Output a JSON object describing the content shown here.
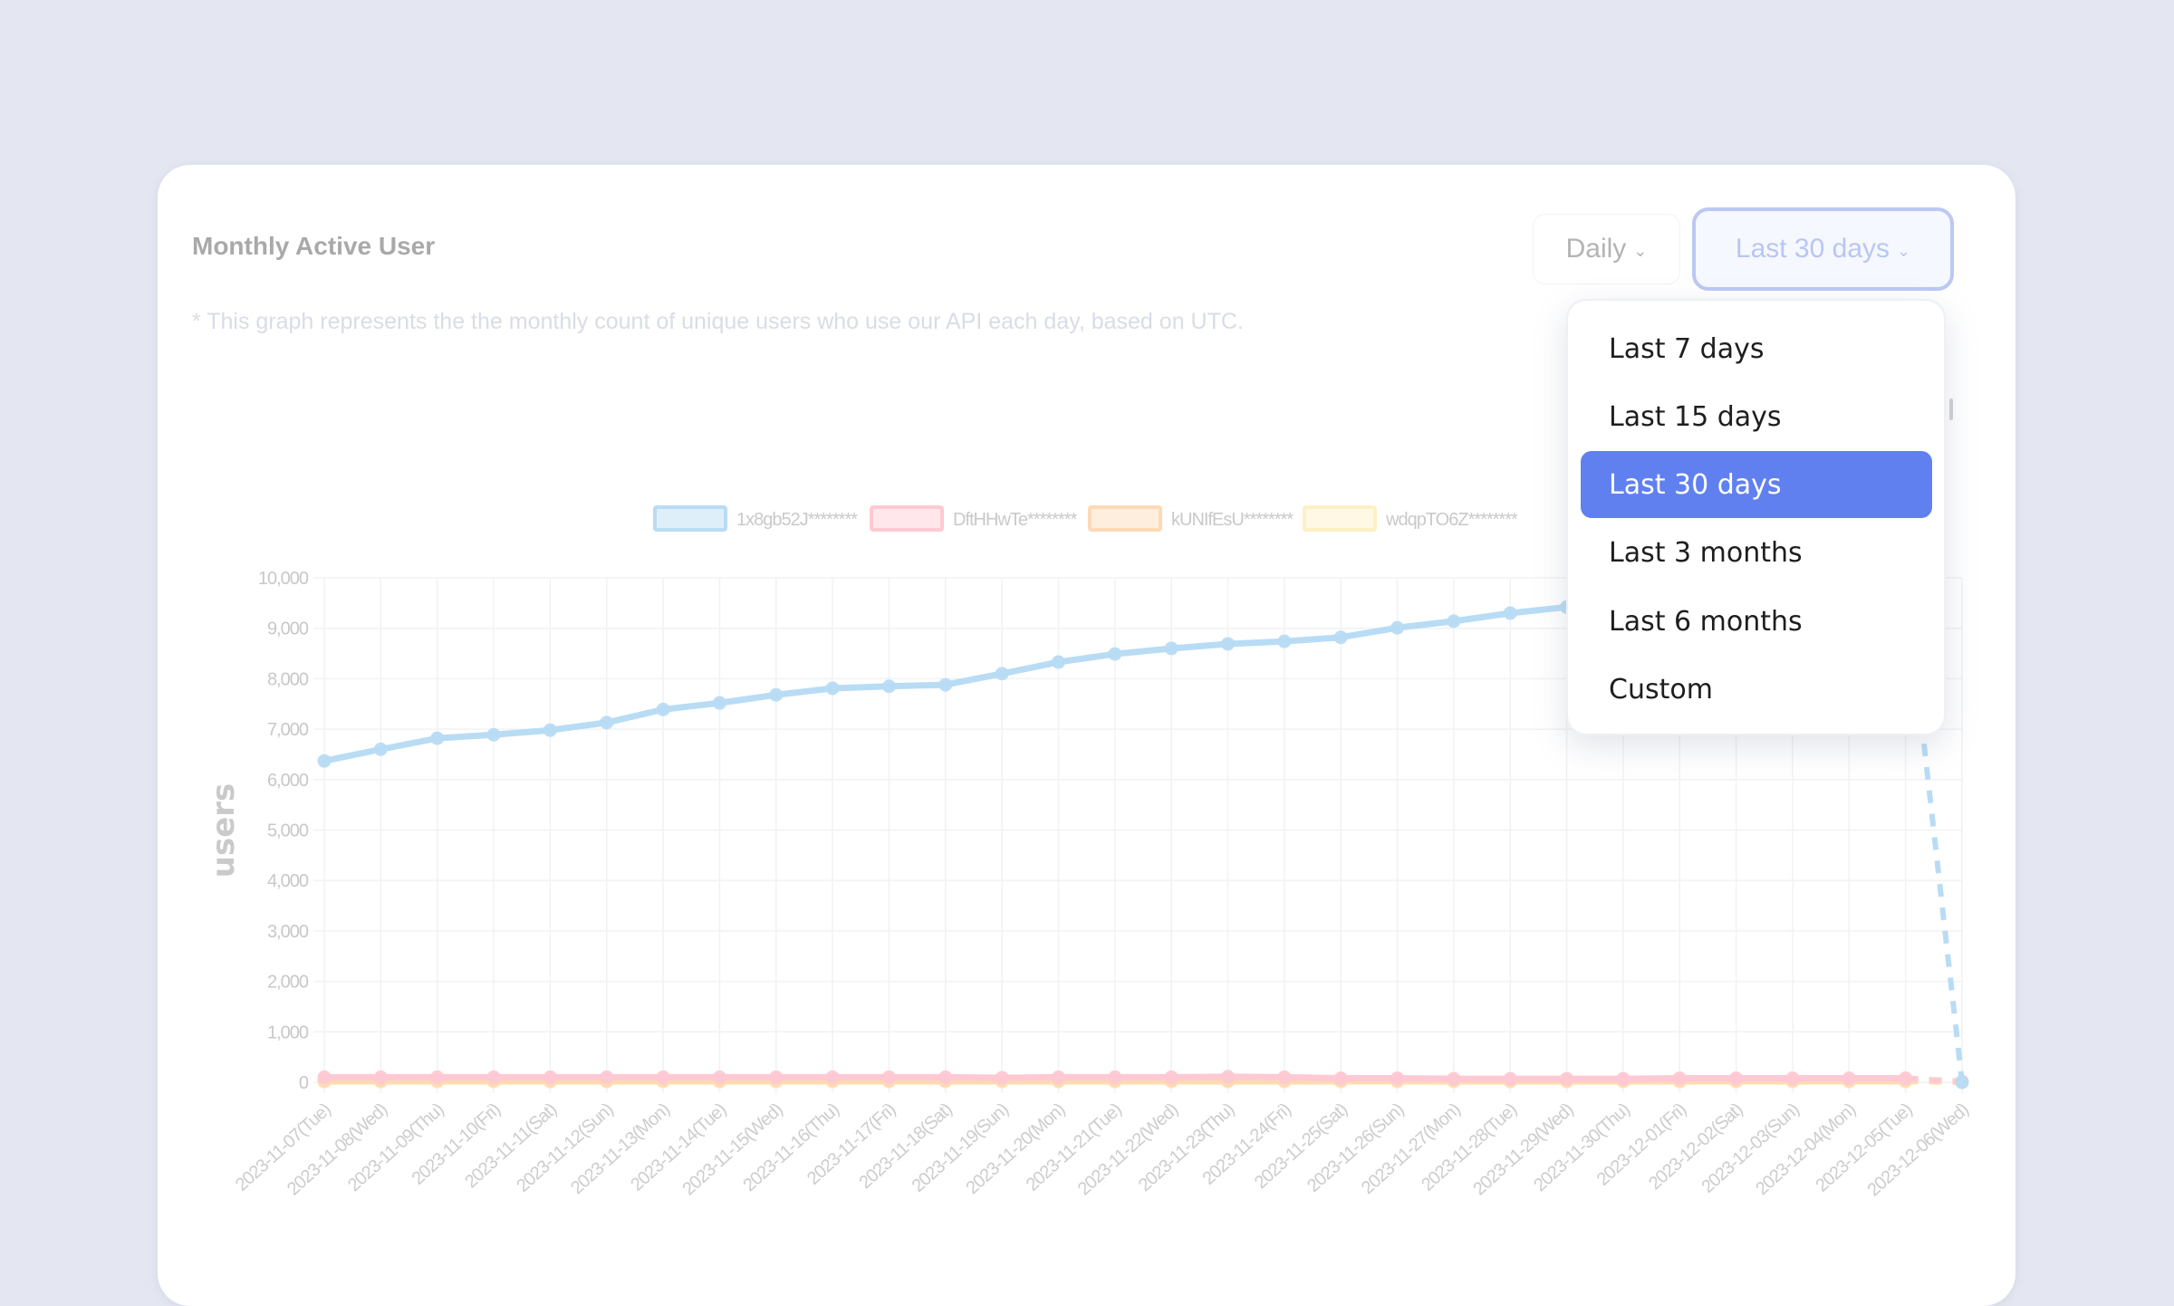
{
  "header": {
    "title": "Monthly Active User",
    "subtitle": "* This graph represents the the monthly count of unique users who use our API each day, based on UTC."
  },
  "controls": {
    "interval": {
      "label": "Daily",
      "icon": "chevron-down-icon"
    },
    "range": {
      "label": "Last 30 days",
      "icon": "chevron-down-icon"
    }
  },
  "dropdown": {
    "items": [
      {
        "label": "Last 7 days",
        "selected": false
      },
      {
        "label": "Last 15 days",
        "selected": false
      },
      {
        "label": "Last 30 days",
        "selected": true
      },
      {
        "label": "Last 3 months",
        "selected": false
      },
      {
        "label": "Last 6 months",
        "selected": false
      },
      {
        "label": "Custom",
        "selected": false
      }
    ]
  },
  "colors": {
    "background": "#E4E7F1",
    "accent": "#6080F0",
    "range_border": "#BCC8F4"
  },
  "chart_data": {
    "type": "line",
    "title": "",
    "xlabel": "",
    "ylabel": "users",
    "ylim": [
      0,
      10000
    ],
    "yticks": [
      0,
      1000,
      2000,
      3000,
      4000,
      5000,
      6000,
      7000,
      8000,
      9000,
      10000
    ],
    "ytick_labels": [
      "0",
      "1,000",
      "2,000",
      "3,000",
      "4,000",
      "5,000",
      "6,000",
      "7,000",
      "8,000",
      "9,000",
      "10,000"
    ],
    "grid": true,
    "legend_position": "top-center",
    "x": [
      "2023-11-07(Tue)",
      "2023-11-08(Wed)",
      "2023-11-09(Thu)",
      "2023-11-10(Fri)",
      "2023-11-11(Sat)",
      "2023-11-12(Sun)",
      "2023-11-13(Mon)",
      "2023-11-14(Tue)",
      "2023-11-15(Wed)",
      "2023-11-16(Thu)",
      "2023-11-17(Fri)",
      "2023-11-18(Sat)",
      "2023-11-19(Sun)",
      "2023-11-20(Mon)",
      "2023-11-21(Tue)",
      "2023-11-22(Wed)",
      "2023-11-23(Thu)",
      "2023-11-24(Fri)",
      "2023-11-25(Sat)",
      "2023-11-26(Sun)",
      "2023-11-27(Mon)",
      "2023-11-28(Tue)",
      "2023-11-29(Wed)",
      "2023-11-30(Thu)",
      "2023-12-01(Fri)",
      "2023-12-02(Sat)",
      "2023-12-03(Sun)",
      "2023-12-04(Mon)",
      "2023-12-05(Tue)",
      "2023-12-06(Wed)"
    ],
    "dashed_last_segment": true,
    "series": [
      {
        "name": "1x8gb52J********",
        "color": "#B9DCF5",
        "values": [
          6370,
          6600,
          6820,
          6890,
          6980,
          7130,
          7390,
          7520,
          7680,
          7810,
          7850,
          7880,
          8100,
          8330,
          8490,
          8600,
          8690,
          8740,
          8820,
          9010,
          9140,
          9300,
          9420,
          9540,
          9650,
          9750,
          9830,
          9900,
          9960,
          0
        ]
      },
      {
        "name": "DftHHwTe********",
        "color": "#FFC9D3",
        "values": [
          100,
          100,
          100,
          100,
          100,
          100,
          100,
          100,
          100,
          100,
          100,
          100,
          90,
          100,
          100,
          100,
          110,
          100,
          80,
          80,
          70,
          70,
          70,
          70,
          80,
          80,
          80,
          80,
          80,
          20
        ]
      },
      {
        "name": "kUNIfEsU********",
        "color": "#FDD9B5",
        "values": [
          30,
          30,
          30,
          30,
          30,
          30,
          30,
          30,
          30,
          30,
          30,
          30,
          30,
          30,
          30,
          30,
          30,
          30,
          30,
          30,
          30,
          30,
          30,
          30,
          30,
          30,
          30,
          30,
          30,
          0
        ]
      },
      {
        "name": "wdqpTO6Z********",
        "color": "#FFEFC4",
        "values": [
          10,
          10,
          10,
          10,
          10,
          10,
          10,
          10,
          10,
          10,
          10,
          10,
          10,
          10,
          10,
          10,
          10,
          10,
          10,
          10,
          10,
          10,
          10,
          10,
          10,
          10,
          10,
          10,
          10,
          0
        ]
      }
    ]
  }
}
